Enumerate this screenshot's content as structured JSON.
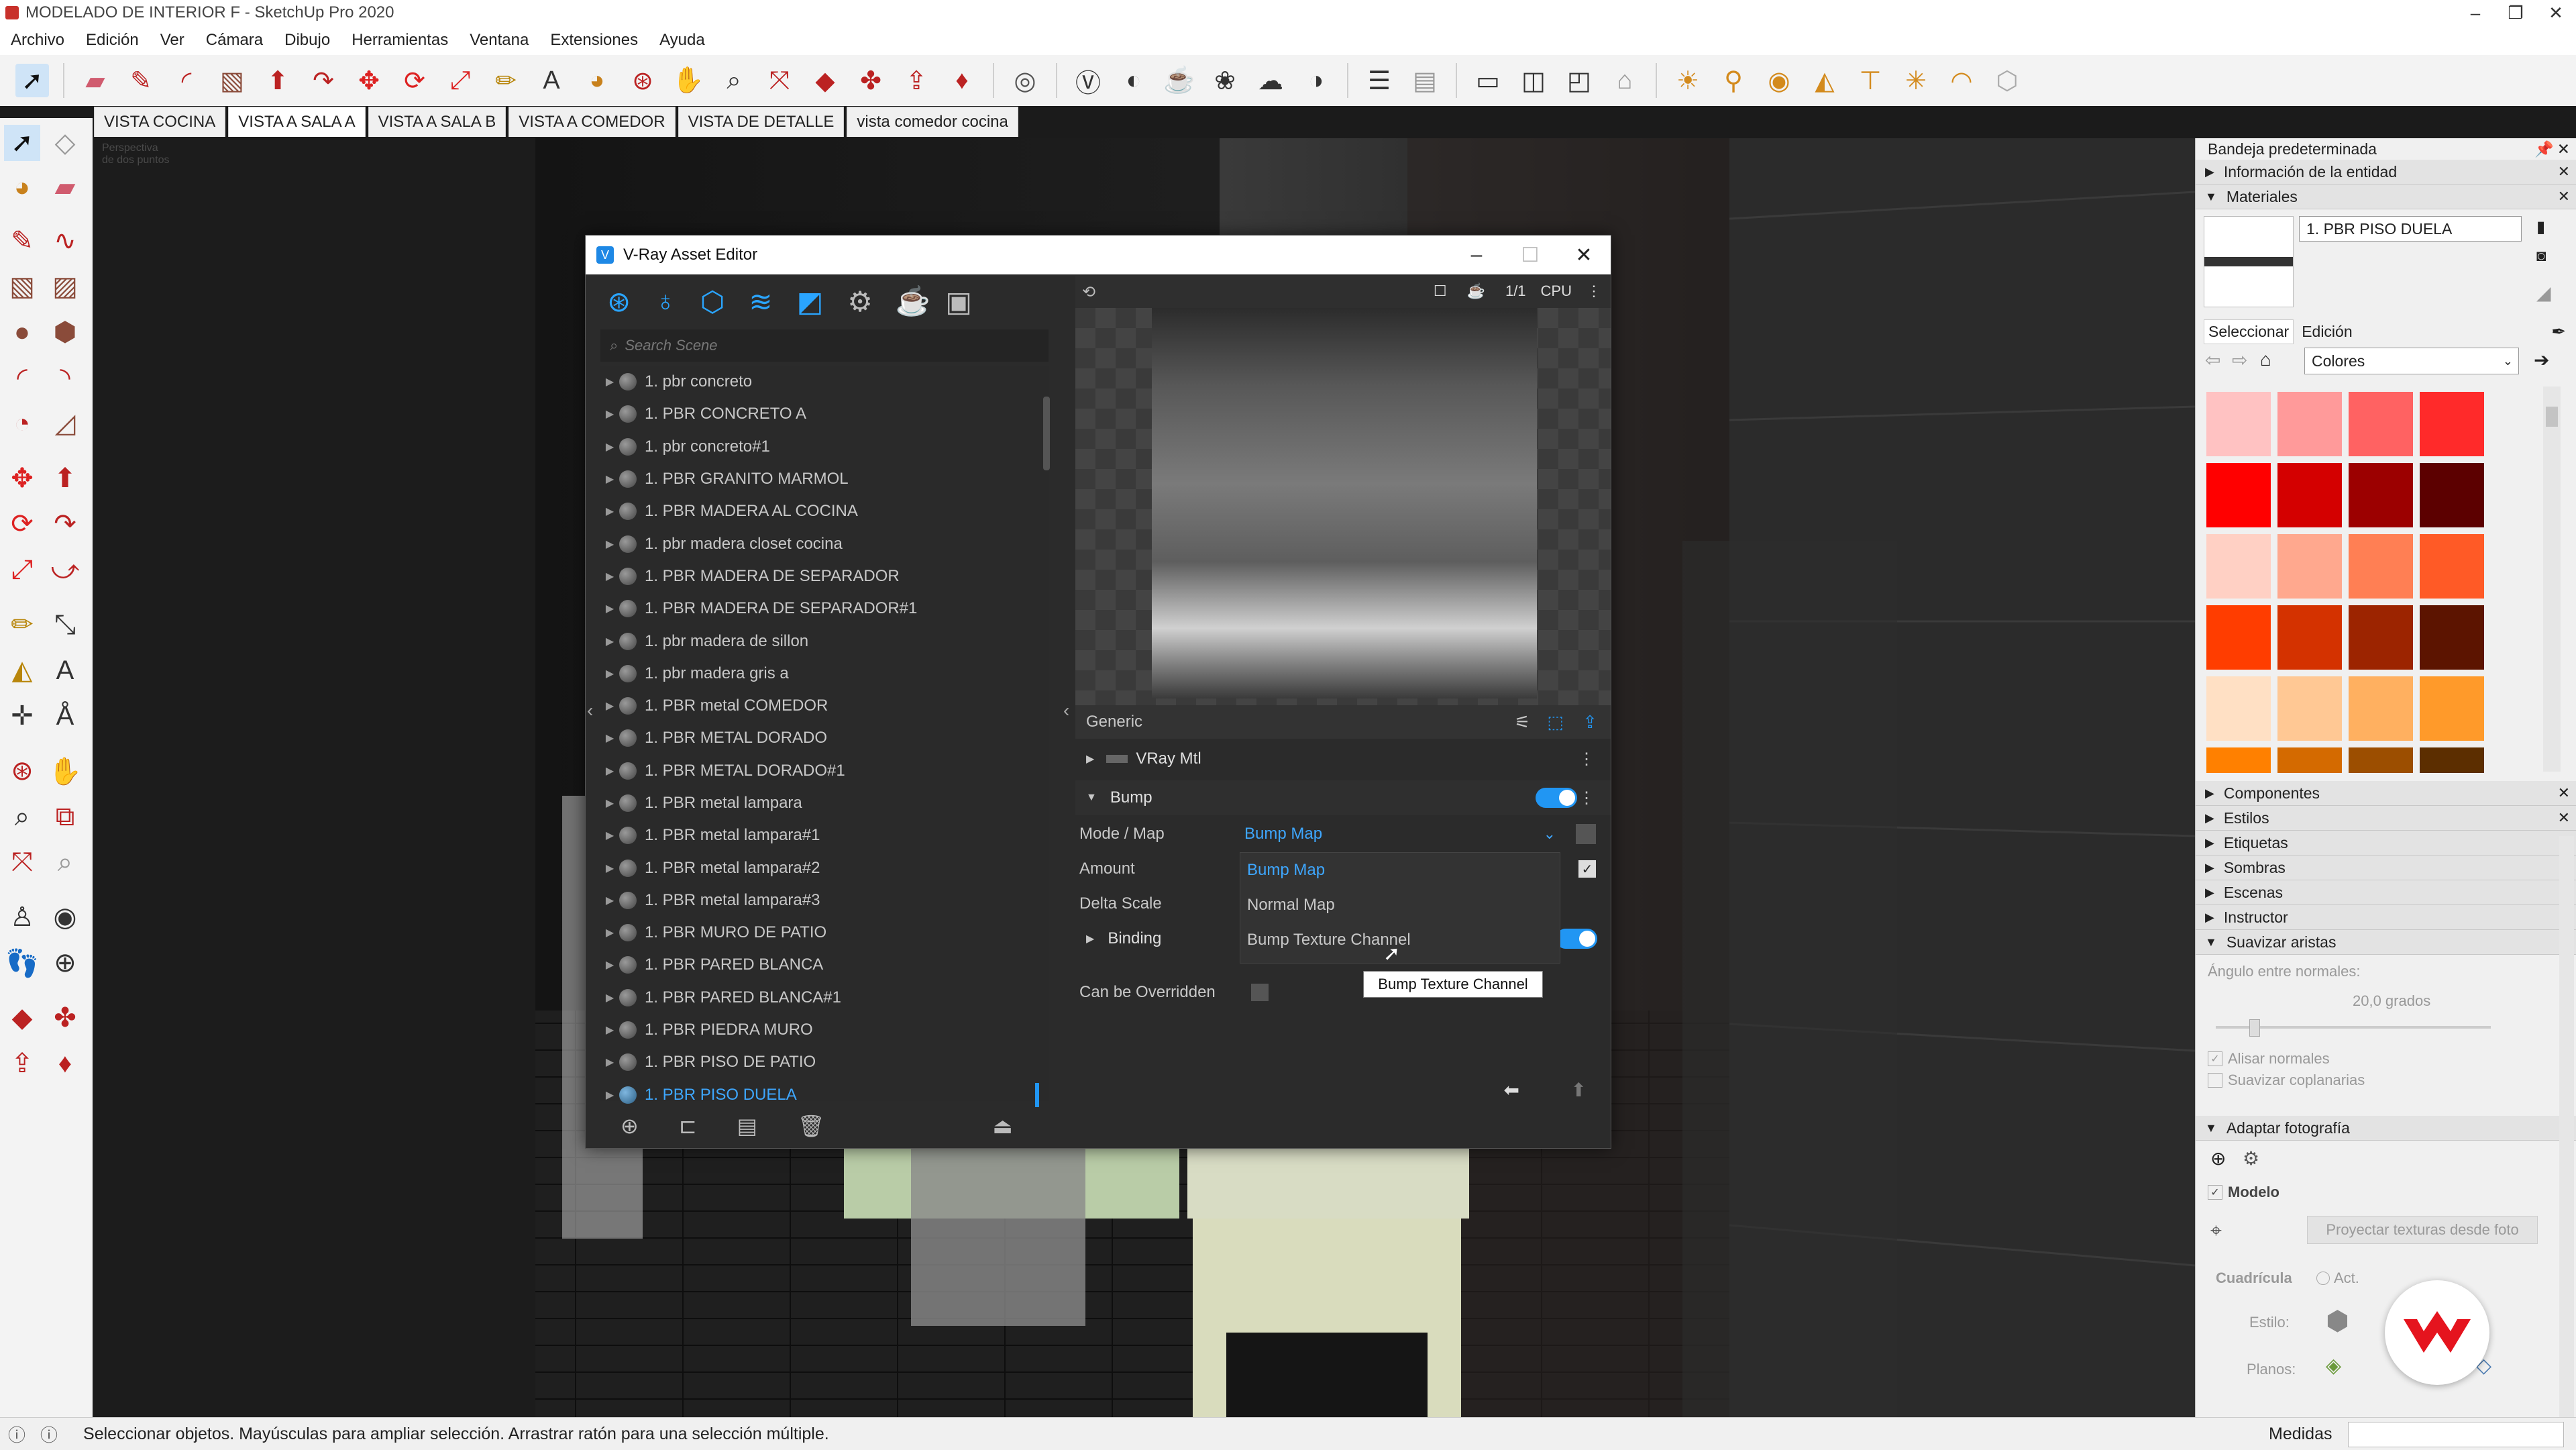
{
  "titlebar": {
    "title": "MODELADO DE INTERIOR F - SketchUp Pro 2020"
  },
  "menu": [
    "Archivo",
    "Edición",
    "Ver",
    "Cámara",
    "Dibujo",
    "Herramientas",
    "Ventana",
    "Extensiones",
    "Ayuda"
  ],
  "scene_tabs": [
    "VISTA COCINA",
    "VISTA A SALA A",
    "VISTA A SALA B",
    "VISTA A COMEDOR",
    "VISTA DE DETALLE",
    "vista comedor cocina"
  ],
  "active_scene": "VISTA A SALA A",
  "viewport": {
    "camera_label_1": "Perspectiva",
    "camera_label_2": "de dos puntos"
  },
  "vray": {
    "title": "V-Ray Asset Editor",
    "search_placeholder": "Search Scene",
    "materials": [
      "1. pbr concreto",
      "1. PBR CONCRETO A",
      "1. pbr concreto#1",
      "1. PBR GRANITO MARMOL",
      "1. PBR MADERA AL COCINA",
      "1. pbr madera closet cocina",
      "1. PBR MADERA DE SEPARADOR",
      "1. PBR MADERA DE SEPARADOR#1",
      "1. pbr madera de sillon",
      "1. pbr madera gris a",
      "1. PBR metal COMEDOR",
      "1. PBR METAL DORADO",
      "1. PBR METAL DORADO#1",
      "1. PBR metal lampara",
      "1. PBR metal lampara#1",
      "1. PBR metal lampara#2",
      "1. PBR metal lampara#3",
      "1. PBR MURO DE PATIO",
      "1. PBR PARED BLANCA",
      "1. PBR PARED BLANCA#1",
      "1. PBR PIEDRA MURO",
      "1. PBR PISO DE PATIO",
      "1. PBR PISO DUELA"
    ],
    "selected_material": "1. PBR PISO DUELA",
    "preview_render": "CPU",
    "preview_ratio": "1/1",
    "props_header": "Generic",
    "vray_mtl": "VRay Mtl",
    "bump_section": "Bump",
    "mode_label": "Mode / Map",
    "mode_value": "Bump Map",
    "amount_label": "Amount",
    "delta_label": "Delta Scale",
    "binding_label": "Binding",
    "override_label": "Can be Overridden",
    "dropdown_options": [
      "Bump Map",
      "Normal Map",
      "Bump Texture Channel"
    ],
    "tooltip": "Bump Texture Channel"
  },
  "tray": {
    "title": "Bandeja predeterminada",
    "entity_info": "Información de la entidad",
    "materials": "Materiales",
    "material_name": "1. PBR PISO DUELA",
    "tab_select": "Seleccionar",
    "tab_edit": "Edición",
    "library": "Colores",
    "panels": [
      "Componentes",
      "Estilos",
      "Etiquetas",
      "Sombras",
      "Escenas",
      "Instructor",
      "Suavizar aristas"
    ],
    "smooth": {
      "angle_label": "Ángulo entre normales:",
      "angle_value": "20,0  grados",
      "smooth_normals": "Alisar normales",
      "soften_coplanar": "Suavizar coplanarias"
    },
    "match_photo": "Adaptar fotografía",
    "model_label": "Modelo",
    "project_button": "Proyectar texturas desde foto",
    "grid_label": "Cuadrícula",
    "act_label": "Act.",
    "style_label": "Estilo:",
    "planes_label": "Planos:"
  },
  "colors": {
    "swatches": [
      "#ffc2c2",
      "#ff9a9a",
      "#ff6262",
      "#ff2a2a",
      "#ff0000",
      "#d40000",
      "#9c0000",
      "#5c0000",
      "#ffd0c4",
      "#ffa88e",
      "#ff7f54",
      "#ff5a26",
      "#ff3d00",
      "#d43200",
      "#9c2400",
      "#5c1400",
      "#ffe0c4",
      "#ffc894",
      "#ffb060",
      "#ff9a2a",
      "#ff8000",
      "#d46a00",
      "#9c4e00",
      "#5c2e00"
    ]
  },
  "status": {
    "message": "Seleccionar objetos. Mayúsculas para ampliar selección. Arrastrar ratón para una selección múltiple.",
    "measures": "Medidas"
  }
}
